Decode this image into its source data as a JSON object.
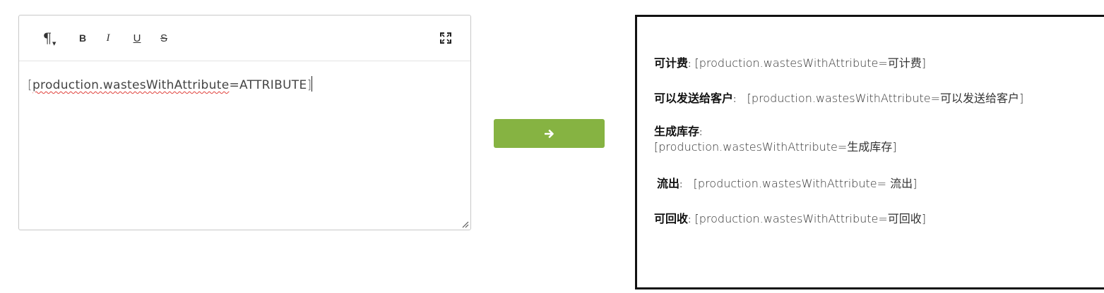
{
  "editor": {
    "toolbar": {
      "paragraph_icon": "pilcrow-icon",
      "bold_label": "B",
      "italic_label": "I",
      "underline_label": "U",
      "strike_label": "S",
      "fullscreen_icon": "fullscreen-icon"
    },
    "content": {
      "open_bracket": "[",
      "token_underlined": "production.wastesWithAttribute",
      "token_rest": "=ATTRIBUTE",
      "close_bracket": "]"
    }
  },
  "convert_button": {
    "icon": "arrow-right-icon",
    "color": "#86b342"
  },
  "preview": {
    "lines": [
      {
        "label": "可计费",
        "sep": ":",
        "value": "[production.wastesWithAttribute=可计费]"
      },
      {
        "label": "可以发送给客户",
        "sep": ":",
        "value": "[production.wastesWithAttribute=可以发送给客户]"
      },
      {
        "label": "生成库存",
        "sep": ":",
        "value": "[production.wastesWithAttribute=生成库存]"
      },
      {
        "label": "流出",
        "sep": ":",
        "value": "[production.wastesWithAttribute= 流出]"
      },
      {
        "label": "可回收",
        "sep": ":",
        "value": "[production.wastesWithAttribute=可回收]"
      }
    ]
  }
}
